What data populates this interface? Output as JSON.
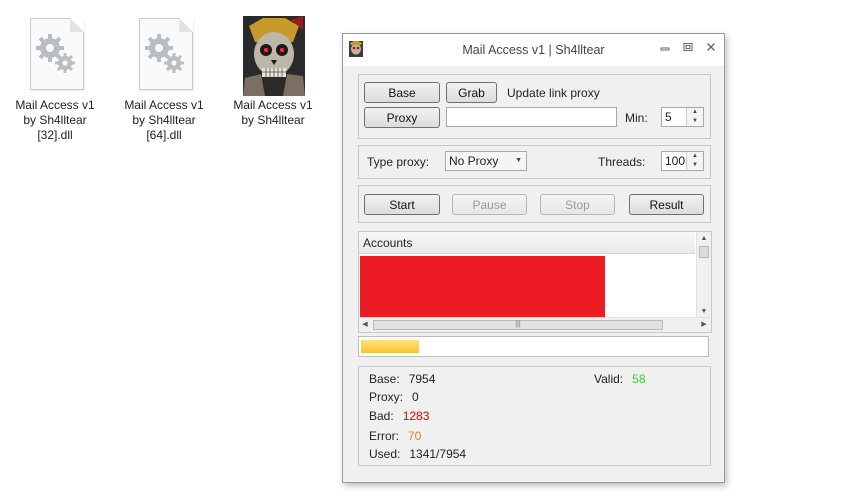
{
  "desktop": {
    "icons": [
      {
        "label": "Mail Access v1\nby Sh4lltear\n[32].dll",
        "icon": "dll-file-icon"
      },
      {
        "label": "Mail Access v1\nby Sh4lltear\n[64].dll",
        "icon": "dll-file-icon"
      },
      {
        "label": "Mail Access v1\nby Sh4lltear",
        "icon": "skull-app-icon"
      }
    ]
  },
  "window": {
    "title": "Mail Access v1 | Sh4lltear",
    "controls": {
      "minimize": "▭",
      "maximize": "□",
      "close": "✕"
    }
  },
  "proxy_group": {
    "base_button": "Base",
    "grab_button": "Grab",
    "update_link_label": "Update link proxy",
    "proxy_button": "Proxy",
    "proxy_link_value": "",
    "min_label": "Min:",
    "min_value": "5"
  },
  "settings_group": {
    "type_proxy_label": "Type proxy:",
    "type_proxy_value": "No Proxy",
    "threads_label": "Threads:",
    "threads_value": "100"
  },
  "actions": {
    "start": "Start",
    "pause": "Pause",
    "stop": "Stop",
    "result": "Result"
  },
  "accounts": {
    "header": "Accounts"
  },
  "progress": {
    "fraction": 0.169
  },
  "stats": {
    "base_label": "Base:",
    "base_value": "7954",
    "valid_label": "Valid:",
    "valid_value": "58",
    "proxy_label": "Proxy:",
    "proxy_value": "0",
    "bad_label": "Bad:",
    "bad_value": "1283",
    "error_label": "Error:",
    "error_value": "70",
    "used_label": "Used:",
    "used_value": "1341/7954"
  },
  "colors": {
    "accounts_fill": "#ed1c24",
    "valid": "#2bd82b",
    "bad": "#e00000",
    "error": "#f07a1e",
    "progress": "#f5c431"
  }
}
